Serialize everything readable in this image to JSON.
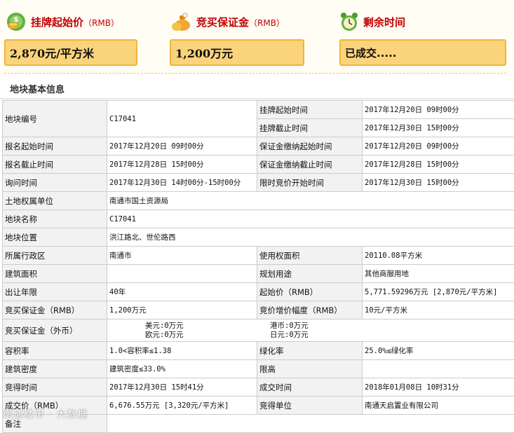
{
  "kpis": {
    "start_price": {
      "label": "挂牌起始价",
      "sub": "（RMB）",
      "value": "2,870元/平方米",
      "icon": "coins-icon"
    },
    "deposit": {
      "label": "竞买保证金",
      "sub": "（RMB）",
      "value": "1,200万元",
      "icon": "money-bag-icon"
    },
    "remaining": {
      "label": "剩余时间",
      "value": "已成交.....",
      "icon": "alarm-clock-icon"
    }
  },
  "section_title": "地块基本信息",
  "table": {
    "r1": {
      "k1": "地块编号",
      "v1": "C17041",
      "k2": "挂牌起始时间",
      "v2": "2017年12月20日 09时00分"
    },
    "r1b": {
      "k2": "挂牌截止时间",
      "v2": "2017年12月30日 15时00分"
    },
    "r2": {
      "k1": "报名起始时间",
      "v1": "2017年12月20日 09时00分",
      "k2": "保证金缴纳起始时间",
      "v2": "2017年12月20日 09时00分"
    },
    "r3": {
      "k1": "报名截止时间",
      "v1": "2017年12月28日 15时00分",
      "k2": "保证金缴纳截止时间",
      "v2": "2017年12月28日 15时00分"
    },
    "r4": {
      "k1": "询问时间",
      "v1": "2017年12月30日 14时00分-15时00分",
      "k2": "限时竞价开始时间",
      "v2": "2017年12月30日 15时00分"
    },
    "r5": {
      "k1": "土地权属单位",
      "v1": "南通市国土资源局"
    },
    "r6": {
      "k1": "地块名称",
      "v1": "C17041"
    },
    "r7": {
      "k1": "地块位置",
      "v1": "洪江路北、世伦路西"
    },
    "r8": {
      "k1": "所属行政区",
      "v1": "南通市",
      "k2": "使用权面积",
      "v2": "20110.08平方米"
    },
    "r9": {
      "k1": "建筑面积",
      "v1": "",
      "k2": "规划用途",
      "v2": "其他商服用地"
    },
    "r10": {
      "k1": "出让年限",
      "v1": "40年",
      "k2": "起始价（RMB）",
      "v2": "5,771.59296万元 [2,870元/平方米]"
    },
    "r11": {
      "k1": "竞买保证金（RMB）",
      "v1": "1,200万元",
      "k2": "竞价增价幅度（RMB）",
      "v2": "10元/平方米"
    },
    "r12": {
      "k1": "竞买保证金（外币）",
      "usd_label": "美元:",
      "usd": "0万元",
      "hkd_label": "港币:",
      "hkd": "0万元",
      "eur_label": "欧元:",
      "eur": "0万元",
      "jpy_label": "日元:",
      "jpy": "0万元"
    },
    "r13": {
      "k1": "容积率",
      "v1": "1.0<容积率≤1.38",
      "k2": "绿化率",
      "v2": "25.0%≤绿化率"
    },
    "r14": {
      "k1": "建筑密度",
      "v1": "建筑密度≤33.0%",
      "k2": "限高",
      "v2": ""
    },
    "r15": {
      "k1": "竞得时间",
      "v1": "2017年12月30日 15时41分",
      "k2": "成交时间",
      "v2": "2018年01月08日 10时31分"
    },
    "r16": {
      "k1": "成交价（RMB）",
      "v1": "6,676.55万元 [3,320元/平方米]",
      "k2": "竞得单位",
      "v2": "南通天启置业有限公司"
    },
    "r17": {
      "k1": "备注",
      "v1": ""
    }
  },
  "watermark": "南通楼市 · 大数据",
  "colors": {
    "accent_red": "#c20000",
    "kpi_fill": "#fbd37a",
    "kpi_border": "#f1b43a",
    "label_bg": "#f2f2f2",
    "grid": "#cccccc"
  }
}
